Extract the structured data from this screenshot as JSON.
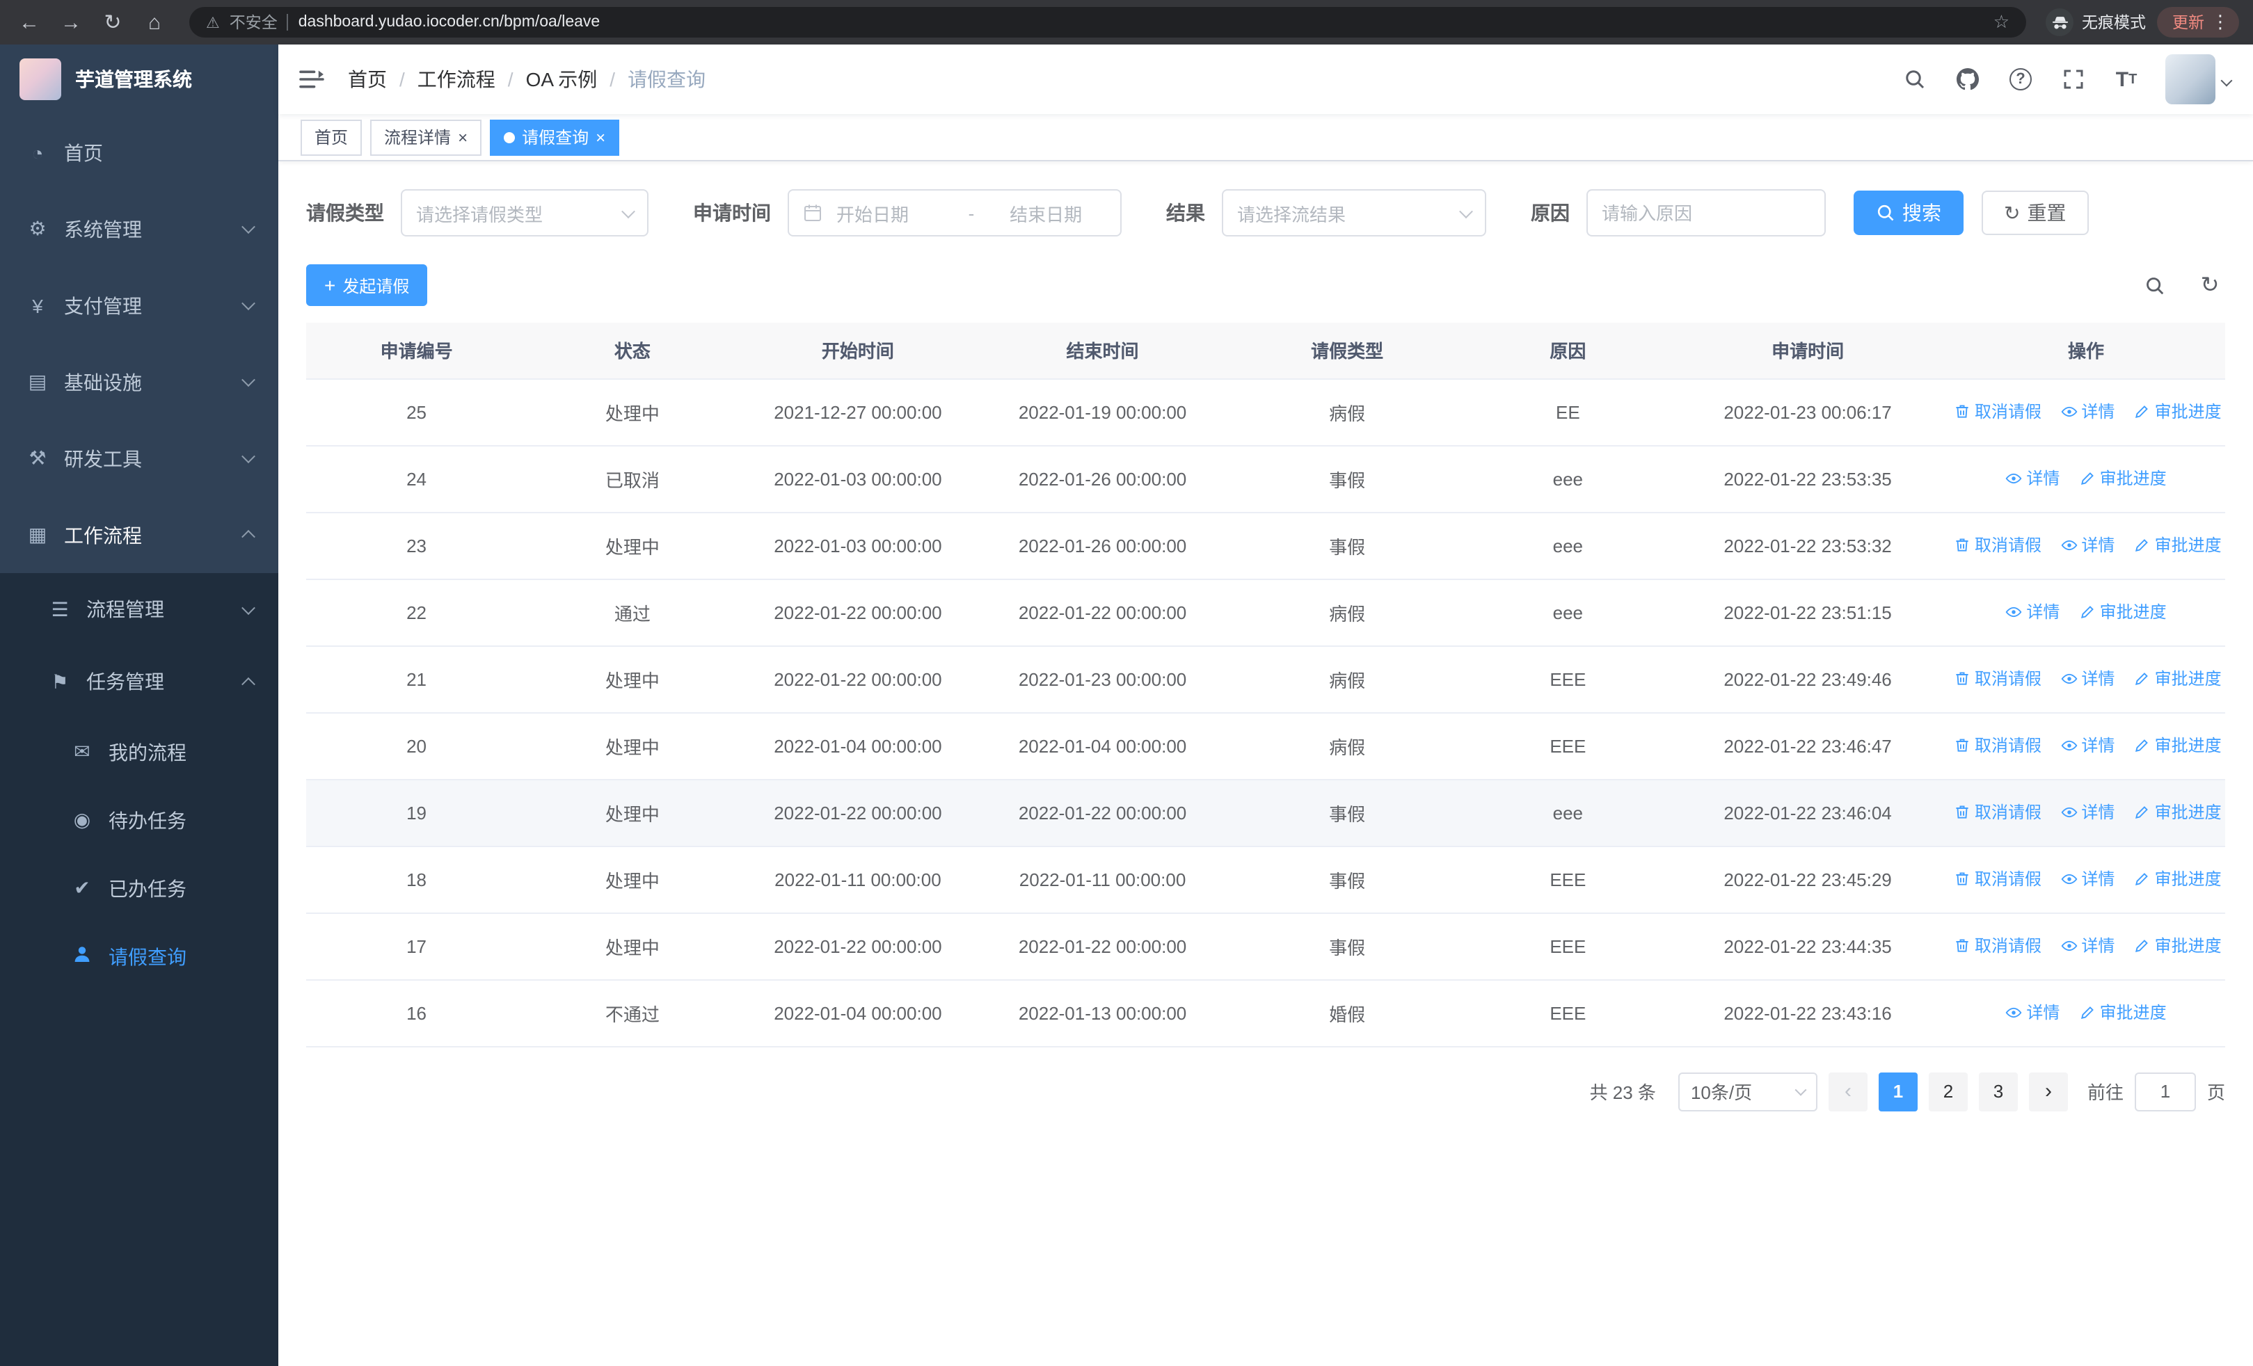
{
  "glyphs": {
    "back": "←",
    "forward": "→",
    "reload": "↻",
    "home": "⌂",
    "warning": "⚠",
    "star": "☆",
    "dots": "⋮",
    "help": "?",
    "plus": "+",
    "close": "×",
    "refresh": "↻",
    "prev": "‹",
    "next": "›",
    "menu": {
      "dashboard": "◔",
      "system": "⚙",
      "pay": "¥",
      "infra": "▤",
      "devtools": "⚒",
      "workflow": "▦",
      "process": "☰",
      "task": "⚑",
      "my_process": "✉",
      "todo": "◉",
      "done": "✔"
    }
  },
  "browser": {
    "security_label": "不安全",
    "url": "dashboard.yudao.iocoder.cn/bpm/oa/leave",
    "incognito_label": "无痕模式",
    "update_label": "更新"
  },
  "sidebar": {
    "logo_title": "芋道管理系统",
    "menu": [
      {
        "label": "首页"
      },
      {
        "label": "系统管理"
      },
      {
        "label": "支付管理"
      },
      {
        "label": "基础设施"
      },
      {
        "label": "研发工具"
      },
      {
        "label": "工作流程"
      },
      {
        "label": "流程管理"
      },
      {
        "label": "任务管理"
      },
      {
        "label": "我的流程"
      },
      {
        "label": "待办任务"
      },
      {
        "label": "已办任务"
      },
      {
        "label": "请假查询"
      }
    ]
  },
  "breadcrumb": {
    "separator": "/",
    "items": [
      "首页",
      "工作流程",
      "OA 示例",
      "请假查询"
    ]
  },
  "tabs": [
    {
      "label": "首页"
    },
    {
      "label": "流程详情"
    },
    {
      "label": "请假查询"
    }
  ],
  "filters": {
    "leave_type_label": "请假类型",
    "leave_type_placeholder": "请选择请假类型",
    "apply_time_label": "申请时间",
    "date_start_placeholder": "开始日期",
    "date_separator": "-",
    "date_end_placeholder": "结束日期",
    "result_label": "结果",
    "result_placeholder": "请选择流结果",
    "reason_label": "原因",
    "reason_placeholder": "请输入原因",
    "search_label": "搜索",
    "reset_label": "重置",
    "create_label": "发起请假"
  },
  "table": {
    "columns": [
      "申请编号",
      "状态",
      "开始时间",
      "结束时间",
      "请假类型",
      "原因",
      "申请时间",
      "操作"
    ],
    "rows": [
      {
        "id": "25",
        "status": "处理中",
        "start": "2021-12-27 00:00:00",
        "end": "2022-01-19 00:00:00",
        "type": "病假",
        "reason": "EE",
        "applied": "2022-01-23 00:06:17",
        "actions": [
          {
            "label": "取消请假",
            "icon": "delete-icon"
          },
          {
            "label": "详情",
            "icon": "eye-icon"
          },
          {
            "label": "审批进度",
            "icon": "edit-icon"
          }
        ]
      },
      {
        "id": "24",
        "status": "已取消",
        "start": "2022-01-03 00:00:00",
        "end": "2022-01-26 00:00:00",
        "type": "事假",
        "reason": "eee",
        "applied": "2022-01-22 23:53:35",
        "actions": [
          {
            "label": "详情",
            "icon": "eye-icon"
          },
          {
            "label": "审批进度",
            "icon": "edit-icon"
          }
        ]
      },
      {
        "id": "23",
        "status": "处理中",
        "start": "2022-01-03 00:00:00",
        "end": "2022-01-26 00:00:00",
        "type": "事假",
        "reason": "eee",
        "applied": "2022-01-22 23:53:32",
        "actions": [
          {
            "label": "取消请假",
            "icon": "delete-icon"
          },
          {
            "label": "详情",
            "icon": "eye-icon"
          },
          {
            "label": "审批进度",
            "icon": "edit-icon"
          }
        ]
      },
      {
        "id": "22",
        "status": "通过",
        "start": "2022-01-22 00:00:00",
        "end": "2022-01-22 00:00:00",
        "type": "病假",
        "reason": "eee",
        "applied": "2022-01-22 23:51:15",
        "actions": [
          {
            "label": "详情",
            "icon": "eye-icon"
          },
          {
            "label": "审批进度",
            "icon": "edit-icon"
          }
        ]
      },
      {
        "id": "21",
        "status": "处理中",
        "start": "2022-01-22 00:00:00",
        "end": "2022-01-23 00:00:00",
        "type": "病假",
        "reason": "EEE",
        "applied": "2022-01-22 23:49:46",
        "actions": [
          {
            "label": "取消请假",
            "icon": "delete-icon"
          },
          {
            "label": "详情",
            "icon": "eye-icon"
          },
          {
            "label": "审批进度",
            "icon": "edit-icon"
          }
        ]
      },
      {
        "id": "20",
        "status": "处理中",
        "start": "2022-01-04 00:00:00",
        "end": "2022-01-04 00:00:00",
        "type": "病假",
        "reason": "EEE",
        "applied": "2022-01-22 23:46:47",
        "actions": [
          {
            "label": "取消请假",
            "icon": "delete-icon"
          },
          {
            "label": "详情",
            "icon": "eye-icon"
          },
          {
            "label": "审批进度",
            "icon": "edit-icon"
          }
        ]
      },
      {
        "id": "19",
        "status": "处理中",
        "start": "2022-01-22 00:00:00",
        "end": "2022-01-22 00:00:00",
        "type": "事假",
        "reason": "eee",
        "applied": "2022-01-22 23:46:04",
        "actions": [
          {
            "label": "取消请假",
            "icon": "delete-icon"
          },
          {
            "label": "详情",
            "icon": "eye-icon"
          },
          {
            "label": "审批进度",
            "icon": "edit-icon"
          }
        ]
      },
      {
        "id": "18",
        "status": "处理中",
        "start": "2022-01-11 00:00:00",
        "end": "2022-01-11 00:00:00",
        "type": "事假",
        "reason": "EEE",
        "applied": "2022-01-22 23:45:29",
        "actions": [
          {
            "label": "取消请假",
            "icon": "delete-icon"
          },
          {
            "label": "详情",
            "icon": "eye-icon"
          },
          {
            "label": "审批进度",
            "icon": "edit-icon"
          }
        ]
      },
      {
        "id": "17",
        "status": "处理中",
        "start": "2022-01-22 00:00:00",
        "end": "2022-01-22 00:00:00",
        "type": "事假",
        "reason": "EEE",
        "applied": "2022-01-22 23:44:35",
        "actions": [
          {
            "label": "取消请假",
            "icon": "delete-icon"
          },
          {
            "label": "详情",
            "icon": "eye-icon"
          },
          {
            "label": "审批进度",
            "icon": "edit-icon"
          }
        ]
      },
      {
        "id": "16",
        "status": "不通过",
        "start": "2022-01-04 00:00:00",
        "end": "2022-01-13 00:00:00",
        "type": "婚假",
        "reason": "EEE",
        "applied": "2022-01-22 23:43:16",
        "actions": [
          {
            "label": "详情",
            "icon": "eye-icon"
          },
          {
            "label": "审批进度",
            "icon": "edit-icon"
          }
        ]
      }
    ]
  },
  "pagination": {
    "total": "共 23 条",
    "page_size": "10条/页",
    "pages": [
      "1",
      "2",
      "3"
    ],
    "goto_label": "前往",
    "goto_value": "1",
    "page_unit": "页"
  }
}
